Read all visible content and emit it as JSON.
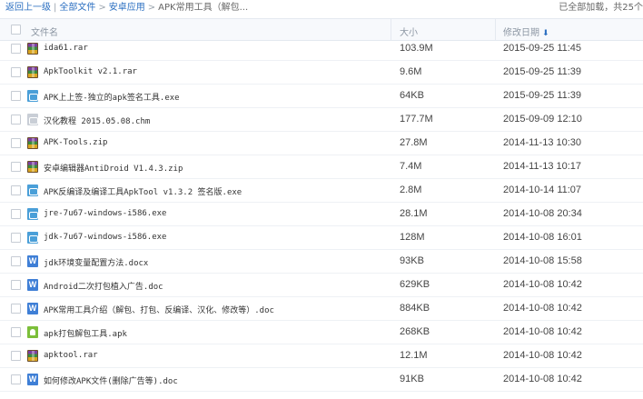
{
  "breadcrumb": {
    "back": "返回上一级",
    "all_files": "全部文件",
    "folder": "安卓应用",
    "current": "APK常用工具（解包..."
  },
  "status": {
    "loaded": "已全部加载，共25个"
  },
  "columns": {
    "name": "文件名",
    "size": "大小",
    "date": "修改日期"
  },
  "icons": {
    "sort": "sort-down-arrow-icon"
  },
  "colors": {
    "link": "#2b6fc1",
    "header_bg": "#f7f9fc",
    "border": "#e4e9f0"
  },
  "files": [
    {
      "name": "ida61.rar",
      "size": "103.9M",
      "date": "2015-09-25 11:45",
      "icon": "rar"
    },
    {
      "name": "ApkToolkit v2.1.rar",
      "size": "9.6M",
      "date": "2015-09-25 11:39",
      "icon": "rar"
    },
    {
      "name": "APK上上签-独立的apk签名工具.exe",
      "size": "64KB",
      "date": "2015-09-25 11:39",
      "icon": "exe"
    },
    {
      "name": "汉化教程 2015.05.08.chm",
      "size": "177.7M",
      "date": "2015-09-09 12:10",
      "icon": "chm"
    },
    {
      "name": "APK-Tools.zip",
      "size": "27.8M",
      "date": "2014-11-13 10:30",
      "icon": "rar"
    },
    {
      "name": "安卓编辑器AntiDroid V1.4.3.zip",
      "size": "7.4M",
      "date": "2014-11-13 10:17",
      "icon": "rar"
    },
    {
      "name": "APK反编译及编译工具ApkTool v1.3.2 签名版.exe",
      "size": "2.8M",
      "date": "2014-10-14 11:07",
      "icon": "exe"
    },
    {
      "name": "jre-7u67-windows-i586.exe",
      "size": "28.1M",
      "date": "2014-10-08 20:34",
      "icon": "exe"
    },
    {
      "name": "jdk-7u67-windows-i586.exe",
      "size": "128M",
      "date": "2014-10-08 16:01",
      "icon": "exe"
    },
    {
      "name": "jdk环境变量配置方法.docx",
      "size": "93KB",
      "date": "2014-10-08 15:58",
      "icon": "doc"
    },
    {
      "name": "Android二次打包植入广告.doc",
      "size": "629KB",
      "date": "2014-10-08 10:42",
      "icon": "doc"
    },
    {
      "name": "APK常用工具介绍（解包、打包、反编译、汉化、修改等）.doc",
      "size": "884KB",
      "date": "2014-10-08 10:42",
      "icon": "doc"
    },
    {
      "name": "apk打包解包工具.apk",
      "size": "268KB",
      "date": "2014-10-08 10:42",
      "icon": "apk"
    },
    {
      "name": "apktool.rar",
      "size": "12.1M",
      "date": "2014-10-08 10:42",
      "icon": "rar"
    },
    {
      "name": "如何修改APK文件(删除广告等).doc",
      "size": "91KB",
      "date": "2014-10-08 10:42",
      "icon": "doc"
    }
  ]
}
